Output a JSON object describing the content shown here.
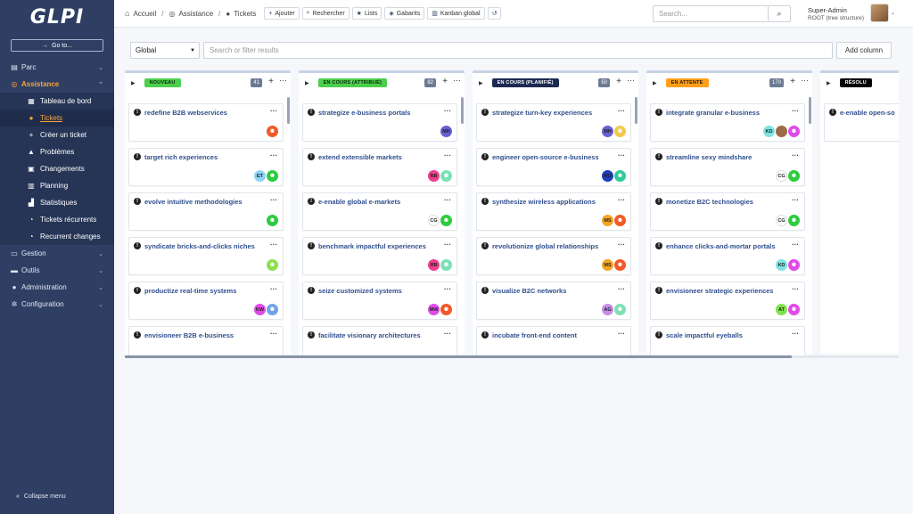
{
  "sidebar": {
    "logo": "GLPI",
    "goto": "Go to...",
    "items": [
      {
        "label": "Parc",
        "icon": "box-icon"
      },
      {
        "label": "Assistance",
        "icon": "lifebuoy-icon",
        "active": true
      },
      {
        "label": "Gestion",
        "icon": "wallet-icon"
      },
      {
        "label": "Outils",
        "icon": "briefcase-icon"
      },
      {
        "label": "Administration",
        "icon": "users-icon"
      },
      {
        "label": "Configuration",
        "icon": "gears-icon"
      }
    ],
    "sub_items": [
      {
        "label": "Tableau de bord",
        "icon": "dashboard-icon"
      },
      {
        "label": "Tickets",
        "icon": "ticket-icon",
        "active": true
      },
      {
        "label": "Créer un ticket",
        "icon": "plus-icon"
      },
      {
        "label": "Problèmes",
        "icon": "warning-icon"
      },
      {
        "label": "Changements",
        "icon": "clipboard-icon"
      },
      {
        "label": "Planning",
        "icon": "calendar-icon"
      },
      {
        "label": "Statistiques",
        "icon": "chart-icon"
      },
      {
        "label": "Tickets récurrents",
        "icon": "stopwatch-icon"
      },
      {
        "label": "Recurrent changes",
        "icon": "stopwatch-icon"
      }
    ],
    "collapse": "Collapse menu"
  },
  "header": {
    "breadcrumb": [
      "Accueil",
      "Assistance",
      "Tickets"
    ],
    "toolbar": [
      "Ajouter",
      "Rechercher",
      "Lists",
      "Gabarits",
      "Kanban global"
    ],
    "search_placeholder": "Search...",
    "user_name": "Super-Admin",
    "user_role": "ROOT (tree structure)"
  },
  "filter": {
    "select_value": "Global",
    "search_placeholder": "Search or filter results",
    "add_column": "Add column"
  },
  "columns": [
    {
      "name": "NOUVEAU",
      "count": "41",
      "badge_bg": "#4ccf4c",
      "badge_fg": "#0b2a0b",
      "cards": [
        {
          "title": "redefine B2B webservices",
          "avatars": [
            {
              "t": "",
              "c": "#f05a28",
              "kind": "group"
            }
          ]
        },
        {
          "title": "target rich experiences",
          "avatars": [
            {
              "t": "ET",
              "c": "#8fd3f4"
            },
            {
              "t": "",
              "c": "#2ecc40",
              "kind": "group"
            }
          ]
        },
        {
          "title": "evolve intuitive methodologies",
          "avatars": [
            {
              "t": "",
              "c": "#2ecc40",
              "kind": "group"
            }
          ]
        },
        {
          "title": "syndicate bricks-and-clicks niches",
          "avatars": [
            {
              "t": "",
              "c": "#8be04e",
              "kind": "group"
            }
          ]
        },
        {
          "title": "productize real-time systems",
          "avatars": [
            {
              "t": "KW",
              "c": "#e04be8"
            },
            {
              "t": "",
              "c": "#6fa4e8",
              "kind": "group"
            }
          ]
        },
        {
          "title": "envisioneer B2B e-business",
          "avatars": []
        }
      ]
    },
    {
      "name": "EN COURS (ATTRIBUÉ)",
      "count": "82",
      "badge_bg": "#4ccf4c",
      "badge_fg": "#0b2a0b",
      "cards": [
        {
          "title": "strategize e-business portals",
          "avatars": [
            {
              "t": "MH",
              "c": "#6b5fd6"
            }
          ]
        },
        {
          "title": "extend extensible markets",
          "avatars": [
            {
              "t": "RB",
              "c": "#f23d8e"
            },
            {
              "t": "",
              "c": "#7ee0b5",
              "kind": "group"
            }
          ]
        },
        {
          "title": "e-enable global e-markets",
          "avatars": [
            {
              "t": "CG",
              "c": "#ffffff"
            },
            {
              "t": "",
              "c": "#2ecc40",
              "kind": "group"
            }
          ]
        },
        {
          "title": "benchmark impactful experiences",
          "avatars": [
            {
              "t": "RB",
              "c": "#f23d8e"
            },
            {
              "t": "",
              "c": "#7ee0b5",
              "kind": "group"
            }
          ]
        },
        {
          "title": "seize customized systems",
          "avatars": [
            {
              "t": "MW",
              "c": "#e04be8"
            },
            {
              "t": "",
              "c": "#f05a28",
              "kind": "group"
            }
          ]
        },
        {
          "title": "facilitate visionary architectures",
          "avatars": []
        }
      ]
    },
    {
      "name": "EN COURS (PLANIFIÉ)",
      "count": "50",
      "badge_bg": "#1c2a52",
      "badge_fg": "#ffffff",
      "cards": [
        {
          "title": "strategize turn-key experiences",
          "avatars": [
            {
              "t": "MH",
              "c": "#6b5fd6"
            },
            {
              "t": "",
              "c": "#f2c94c",
              "kind": "group"
            }
          ]
        },
        {
          "title": "engineer open-source e-business",
          "avatars": [
            {
              "t": "RO",
              "c": "#1f3fbf"
            },
            {
              "t": "",
              "c": "#2ecc98",
              "kind": "group"
            }
          ]
        },
        {
          "title": "synthesize wireless applications",
          "avatars": [
            {
              "t": "MS",
              "c": "#f5a623"
            },
            {
              "t": "",
              "c": "#f05a28",
              "kind": "group"
            }
          ]
        },
        {
          "title": "revolutionize global relationships",
          "avatars": [
            {
              "t": "MS",
              "c": "#f5a623"
            },
            {
              "t": "",
              "c": "#f05a28",
              "kind": "group"
            }
          ]
        },
        {
          "title": "visualize B2C networks",
          "avatars": [
            {
              "t": "AG",
              "c": "#c78be8"
            },
            {
              "t": "",
              "c": "#7ee0b5",
              "kind": "group"
            }
          ]
        },
        {
          "title": "incubate front-end content",
          "avatars": []
        }
      ]
    },
    {
      "name": "EN ATTENTE",
      "count": "170",
      "badge_bg": "#ff9f1a",
      "badge_fg": "#2a1a00",
      "cards": [
        {
          "title": "integrate granular e-business",
          "avatars": [
            {
              "t": "KD",
              "c": "#7fe3e3"
            },
            {
              "t": "",
              "c": "#9b6b48",
              "kind": "photo"
            },
            {
              "t": "",
              "c": "#e04be8",
              "kind": "group"
            }
          ]
        },
        {
          "title": "streamline sexy mindshare",
          "avatars": [
            {
              "t": "CG",
              "c": "#ffffff"
            },
            {
              "t": "",
              "c": "#2ecc40",
              "kind": "group"
            }
          ]
        },
        {
          "title": "monetize B2C technologies",
          "avatars": [
            {
              "t": "CG",
              "c": "#ffffff"
            },
            {
              "t": "",
              "c": "#2ecc40",
              "kind": "group"
            }
          ]
        },
        {
          "title": "enhance clicks-and-mortar portals",
          "avatars": [
            {
              "t": "KD",
              "c": "#7fe3e3"
            },
            {
              "t": "",
              "c": "#e04be8",
              "kind": "group"
            }
          ]
        },
        {
          "title": "envisioneer strategic experiences",
          "avatars": [
            {
              "t": "AT",
              "c": "#7fe34f"
            },
            {
              "t": "",
              "c": "#e04be8",
              "kind": "group"
            }
          ]
        },
        {
          "title": "scale impactful eyeballs",
          "avatars": []
        }
      ]
    },
    {
      "name": "RÉSOLU",
      "count": "",
      "badge_bg": "#000000",
      "badge_fg": "#ffffff",
      "cards": [
        {
          "title": "e-enable open-so",
          "avatars": []
        }
      ]
    }
  ]
}
